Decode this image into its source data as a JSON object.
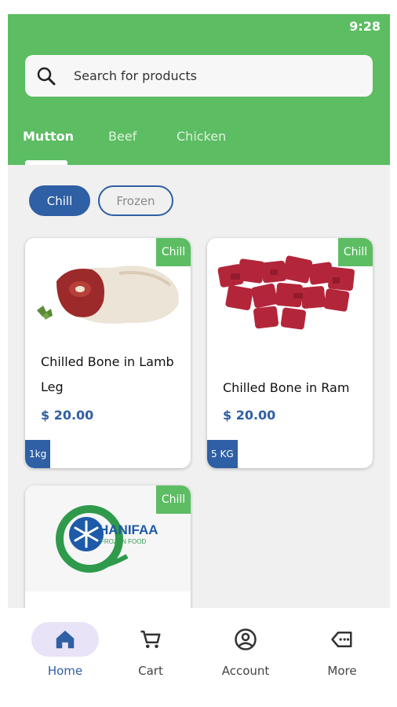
{
  "status_bar": {
    "time": "9:28"
  },
  "search": {
    "placeholder": "Search for products"
  },
  "tabs": [
    {
      "label": "Mutton",
      "active": true
    },
    {
      "label": "Beef",
      "active": false
    },
    {
      "label": "Chicken",
      "active": false
    }
  ],
  "filters": [
    {
      "label": "Chill",
      "selected": true
    },
    {
      "label": "Frozen",
      "selected": false
    }
  ],
  "products": [
    {
      "name": "Chilled Bone in Lamb Leg",
      "price": "$ 20.00",
      "badge": "Chill",
      "qty": "1kg",
      "image": "lamb-leg"
    },
    {
      "name": "Chilled Bone in Ram",
      "price": "$ 20.00",
      "badge": "Chill",
      "qty": "5 KG",
      "image": "diced-meat"
    },
    {
      "badge": "Chill",
      "image": "hanifaa-frozen-food-logo",
      "logo_text": {
        "line1": "HANIFAA",
        "line2": "FROZEN FOOD"
      }
    }
  ],
  "bottom_nav": [
    {
      "label": "Home",
      "icon": "home-icon",
      "active": true
    },
    {
      "label": "Cart",
      "icon": "cart-icon",
      "active": false
    },
    {
      "label": "Account",
      "icon": "account-icon",
      "active": false
    },
    {
      "label": "More",
      "icon": "more-icon",
      "active": false
    }
  ],
  "colors": {
    "header_green": "#5cbd62",
    "accent_blue": "#2f5fa4",
    "background": "#f0f0f0",
    "nav_pill": "#e8e3f7"
  }
}
